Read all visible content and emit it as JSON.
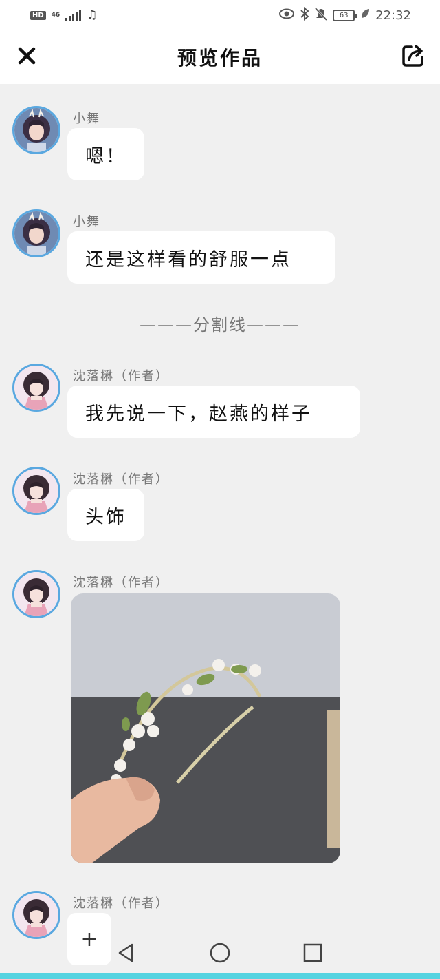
{
  "status_bar": {
    "hd": "HD",
    "network": "46",
    "battery": "63",
    "time": "22:32"
  },
  "nav": {
    "title": "预览作品"
  },
  "messages": [
    {
      "name": "小舞",
      "text": "嗯！"
    },
    {
      "name": "小舞",
      "text": "还是这样看的舒服一点"
    },
    {
      "name": "沈落楙（作者）",
      "text": "我先说一下，赵燕的样子"
    },
    {
      "name": "沈落楙（作者）",
      "text": "头饰"
    },
    {
      "name": "沈落楙（作者）",
      "image": "hairband-photo"
    },
    {
      "name": "沈落楙（作者）"
    }
  ],
  "divider": "———分割线———",
  "compose": {
    "plus": "+"
  },
  "icons": {
    "close": "close-icon",
    "share": "share-icon",
    "back": "back-triangle-icon",
    "home": "home-circle-icon",
    "recents": "recents-square-icon"
  },
  "colors": {
    "accent": "#5aa8e0",
    "bottom_strip": "#55d3e0",
    "background": "#f0f0f0"
  }
}
